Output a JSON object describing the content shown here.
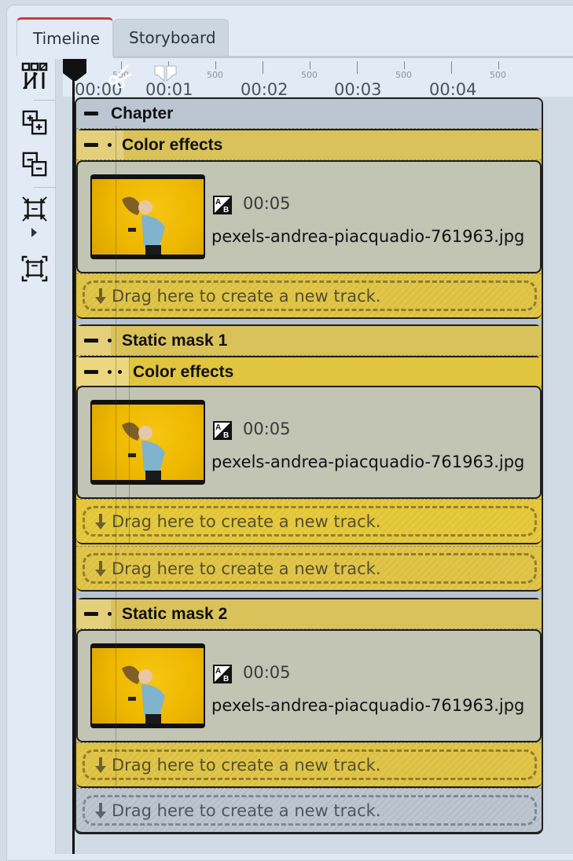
{
  "tabs": [
    {
      "label": "Timeline",
      "active": true
    },
    {
      "label": "Storyboard",
      "active": false
    }
  ],
  "toolbar": {
    "tools": [
      {
        "icon": "split-tracks-icon",
        "name": "split-tracks-button"
      },
      {
        "icon": "expand-all-icon",
        "name": "expand-all-button"
      },
      {
        "icon": "collapse-all-icon",
        "name": "collapse-all-button"
      },
      {
        "icon": "shrink-view-icon",
        "name": "shrink-view-button"
      },
      {
        "icon": "expand-view-icon",
        "name": "expand-view-button"
      }
    ]
  },
  "ruler": {
    "time_labels": [
      "00:00",
      "00:01",
      "00:02",
      "00:03",
      "00:04"
    ],
    "sub_labels": [
      "500",
      "500",
      "500",
      "500",
      "500"
    ]
  },
  "chapter": {
    "label": "Chapter"
  },
  "groups": [
    {
      "label": "Color effects",
      "clip": {
        "duration": "00:05",
        "filename": "pexels-andrea-piacquadio-761963.jpg"
      },
      "drop_text": "Drag here to create a new track."
    },
    {
      "label": "Static mask 1",
      "inner": {
        "label": "Color effects",
        "clip": {
          "duration": "00:05",
          "filename": "pexels-andrea-piacquadio-761963.jpg"
        },
        "drop_text": "Drag here to create a new track."
      },
      "drop_text": "Drag here to create a new track."
    },
    {
      "label": "Static mask 2",
      "clip": {
        "duration": "00:05",
        "filename": "pexels-andrea-piacquadio-761963.jpg"
      },
      "drop_text": "Drag here to create a new track."
    }
  ],
  "chapter_drop_text": "Drag here to create a new track.",
  "colors": {
    "tab_accent": "#d03a3a",
    "effect_yellow": "#e2c53f",
    "chapter_grey": "#b9c3cf",
    "clip_grey": "#c2c4b4"
  }
}
